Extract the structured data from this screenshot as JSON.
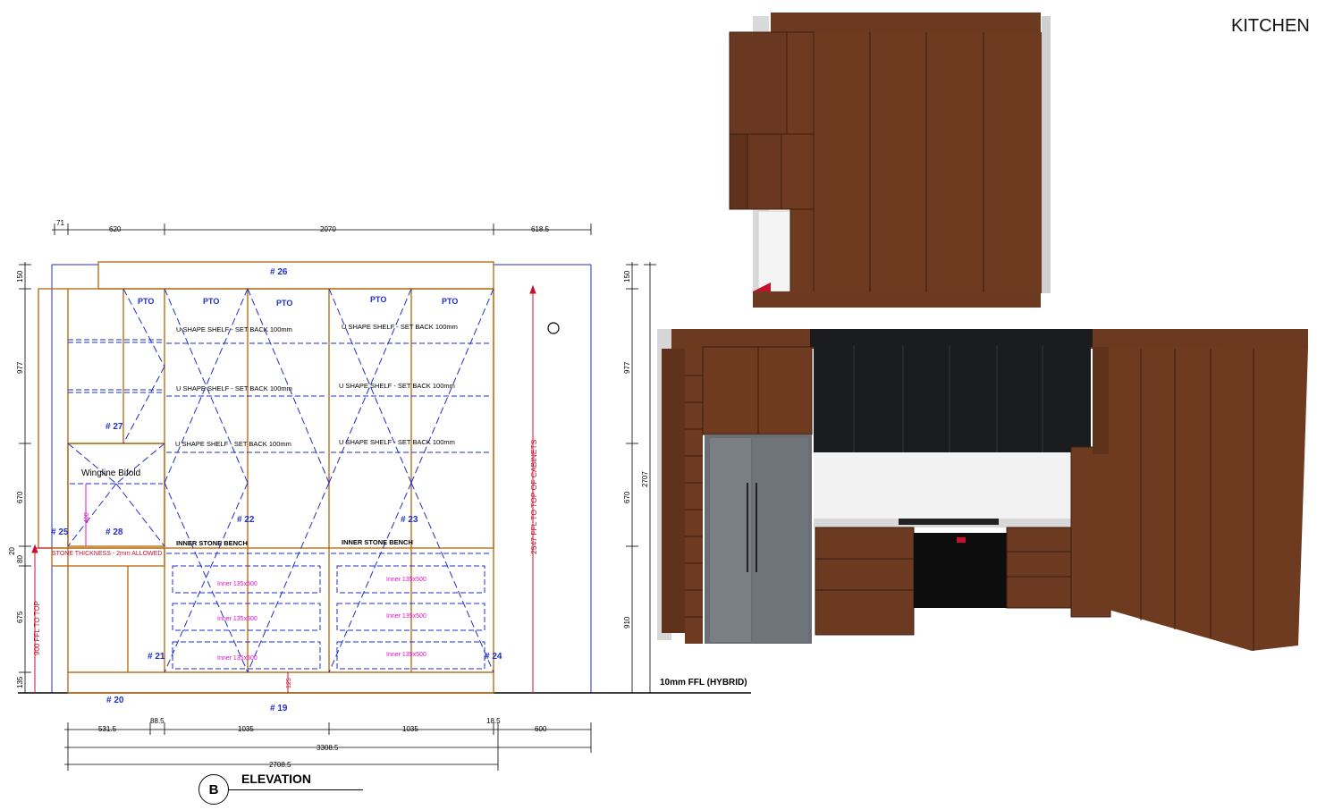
{
  "page": {
    "title": "KITCHEN"
  },
  "elevation": {
    "badge": "B",
    "title": "ELEVATION",
    "ffl_label": "10mm FFL (HYBRID)"
  },
  "dimensions": {
    "top_row": [
      "71",
      "620",
      "2070",
      "618.5"
    ],
    "bottom_row1": [
      "531.5",
      "88.5",
      "1035",
      "1035",
      "18.5",
      "600"
    ],
    "total_1": "3308.5",
    "total_2": "2708.5",
    "left_stack": [
      "150",
      "977",
      "670",
      "20",
      "80",
      "675",
      "135"
    ],
    "right_stack": [
      "150",
      "977",
      "670",
      "910"
    ],
    "right_total": "2707",
    "ffl_to_top": "900 FFL TO TOP",
    "cabinets_top": "2547 FFL TO TOP OF CABINETS",
    "plinth": "125",
    "bifold_height": "400"
  },
  "cabinet_tags": {
    "t26": "# 26",
    "t27": "# 27",
    "t25": "# 25",
    "t28": "# 28",
    "t22": "# 22",
    "t23": "# 23",
    "t21": "# 21",
    "t24": "# 24",
    "t20": "# 20",
    "t19": "# 19"
  },
  "pto": [
    "PTO",
    "PTO",
    "PTO",
    "PTO",
    "PTO"
  ],
  "notes": {
    "shelf": "U SHAPE SHELF - SET BACK 100mm",
    "bench": "INNER STONE BENCH",
    "bifold": "Wingline Bifold",
    "stone": "STONE THICKNESS - 2mm ALLOWED",
    "inner": "Inner 135x500"
  },
  "colors": {
    "carcass": "#b8711a",
    "dimension": "#1f2fc7",
    "accent_red": "#c8102e",
    "magenta": "#e010c8",
    "timber": "#6b3a20",
    "black_cab": "#1b1c1e"
  }
}
